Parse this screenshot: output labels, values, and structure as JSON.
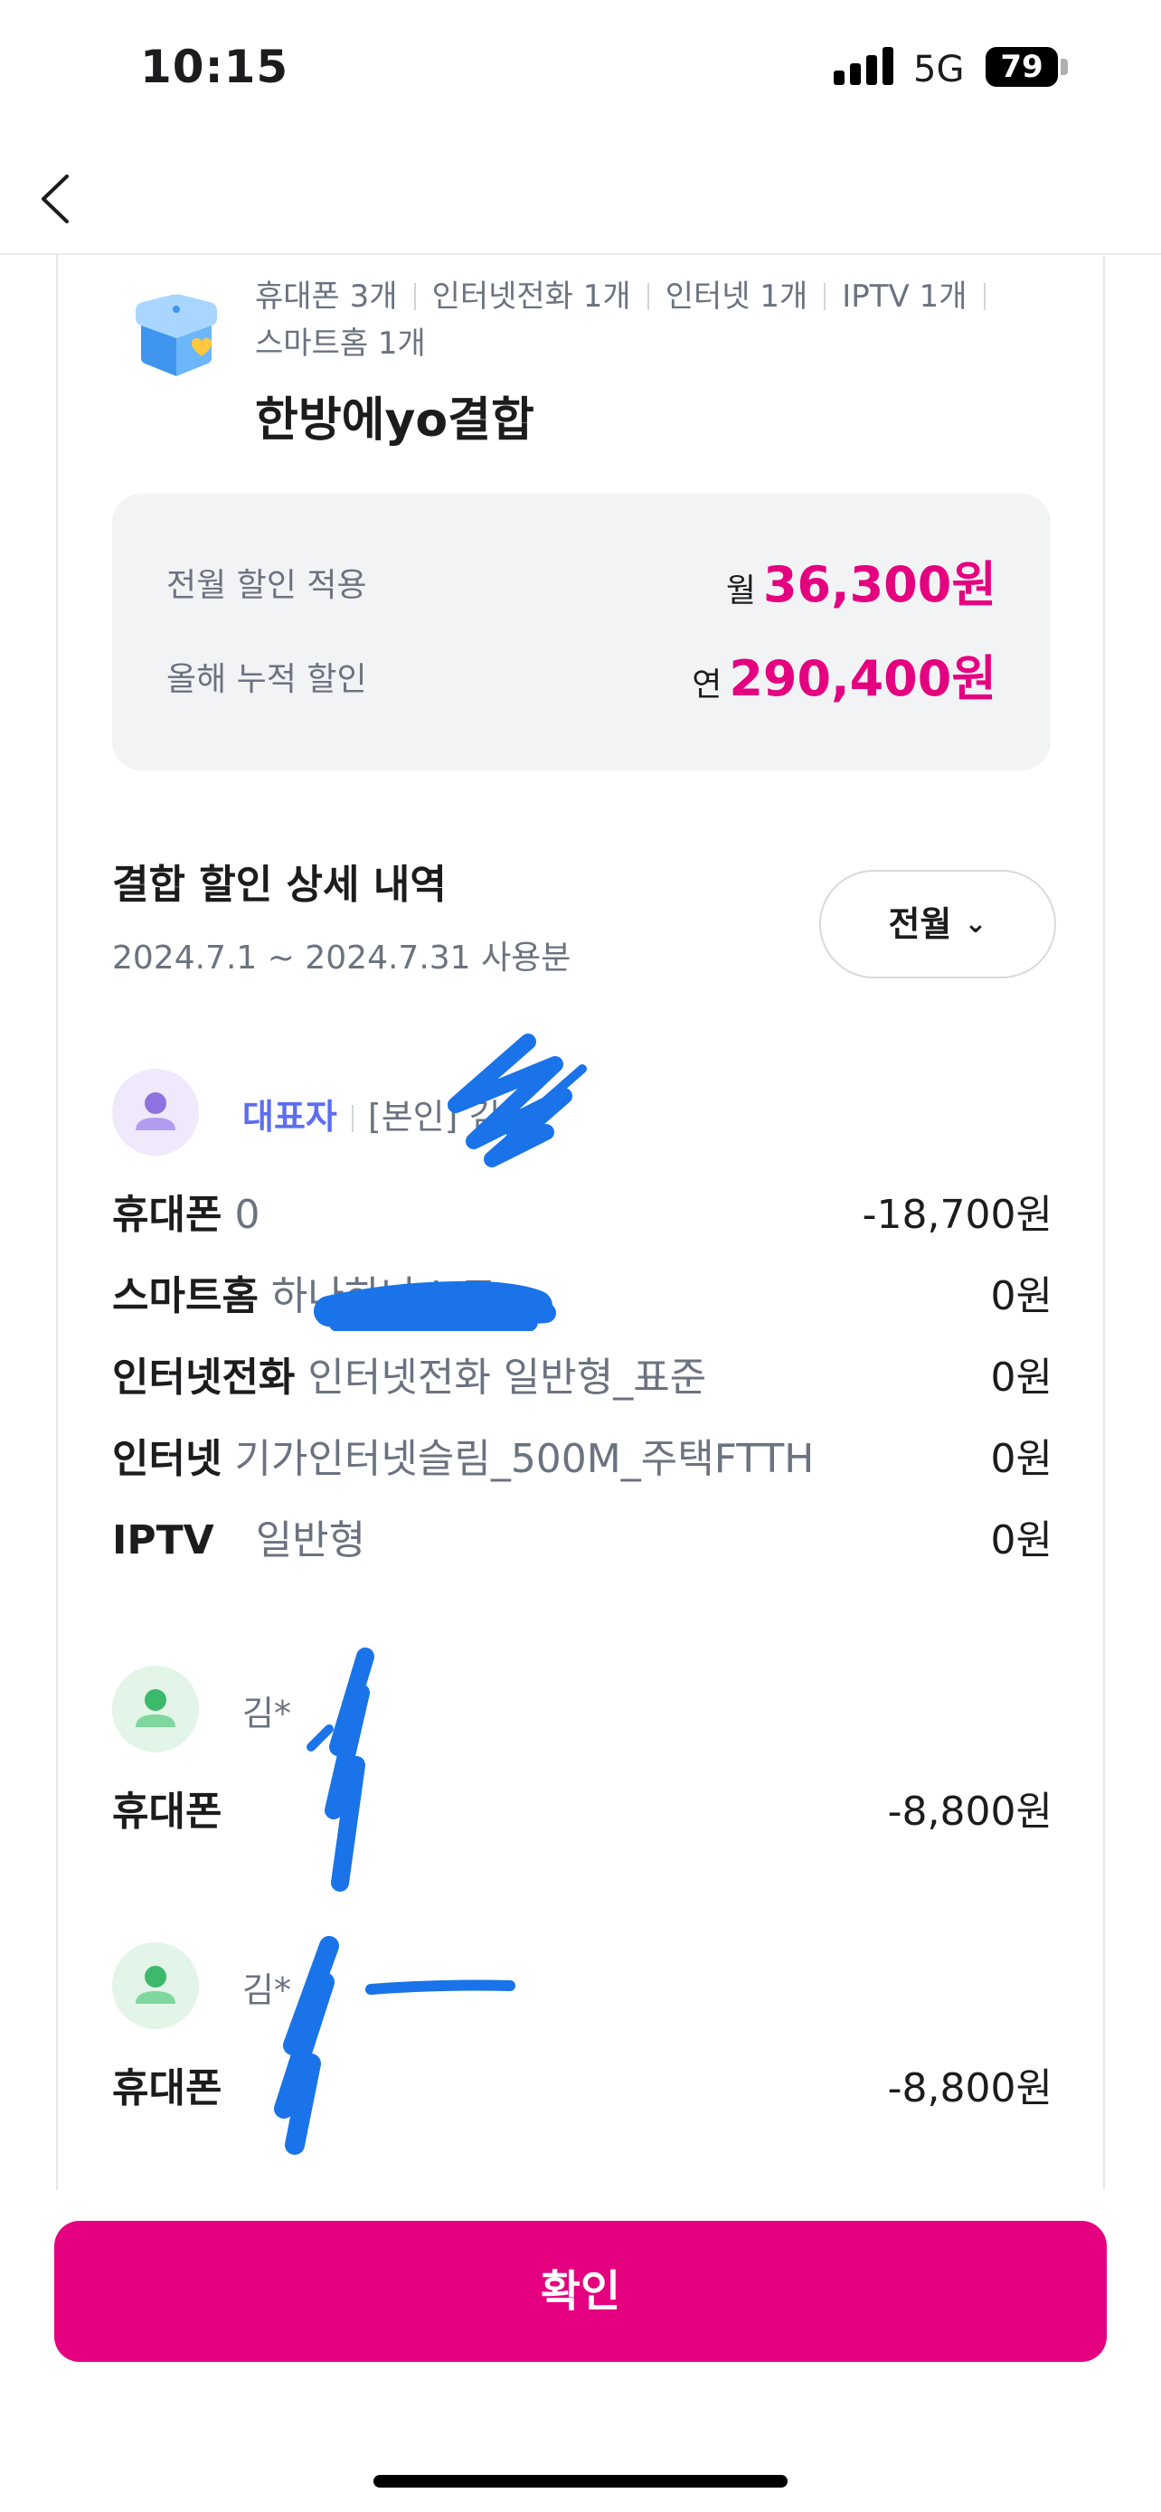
{
  "status_bar": {
    "time": "10:15",
    "network": "5G",
    "battery": "79"
  },
  "nav": {
    "back_icon": "chevron-left-icon"
  },
  "product": {
    "icon": "gift-box-heart-icon",
    "tags": [
      "휴대폰 3개",
      "인터넷전화 1개",
      "인터넷 1개",
      "IPTV 1개",
      "스마트홈 1개"
    ],
    "title": "한방에yo결합"
  },
  "summary": {
    "last_month_label": "전월 할인 적용",
    "last_month_prefix": "월",
    "last_month_amount": "36,300원",
    "year_label": "올해 누적 할인",
    "year_prefix": "연",
    "year_amount": "290,400원"
  },
  "detail": {
    "title": "결합 할인 상세 내역",
    "period": "2024.7.1 ~ 2024.7.31 사용분",
    "month_filter": "전월"
  },
  "members": [
    {
      "badge": "대표자",
      "relation": "[본인]",
      "name": "김",
      "lines": [
        {
          "category": "휴대폰",
          "plan": "0",
          "amount": "-18,700원"
        },
        {
          "category": "스마트홈",
          "plan": "하나하나 IoT",
          "amount": "0원"
        },
        {
          "category": "인터넷전화",
          "plan": "인터넷전화 일반형_표준",
          "amount": "0원"
        },
        {
          "category": "인터넷",
          "plan": "기가인터넷슬림_500M_주택FTTH",
          "amount": "0원"
        },
        {
          "category": "IPTV",
          "plan": "일반형",
          "amount": "0원"
        }
      ]
    },
    {
      "name": "김*",
      "lines": [
        {
          "category": "휴대폰",
          "plan": "",
          "amount": "-8,800원"
        }
      ]
    },
    {
      "name": "김*",
      "lines": [
        {
          "category": "휴대폰",
          "plan": "",
          "amount": "-8,800원"
        }
      ]
    }
  ],
  "confirm_label": "확인",
  "colors": {
    "accent": "#e4007f",
    "representative": "#5b6df0",
    "scribble": "#1a73e8"
  }
}
